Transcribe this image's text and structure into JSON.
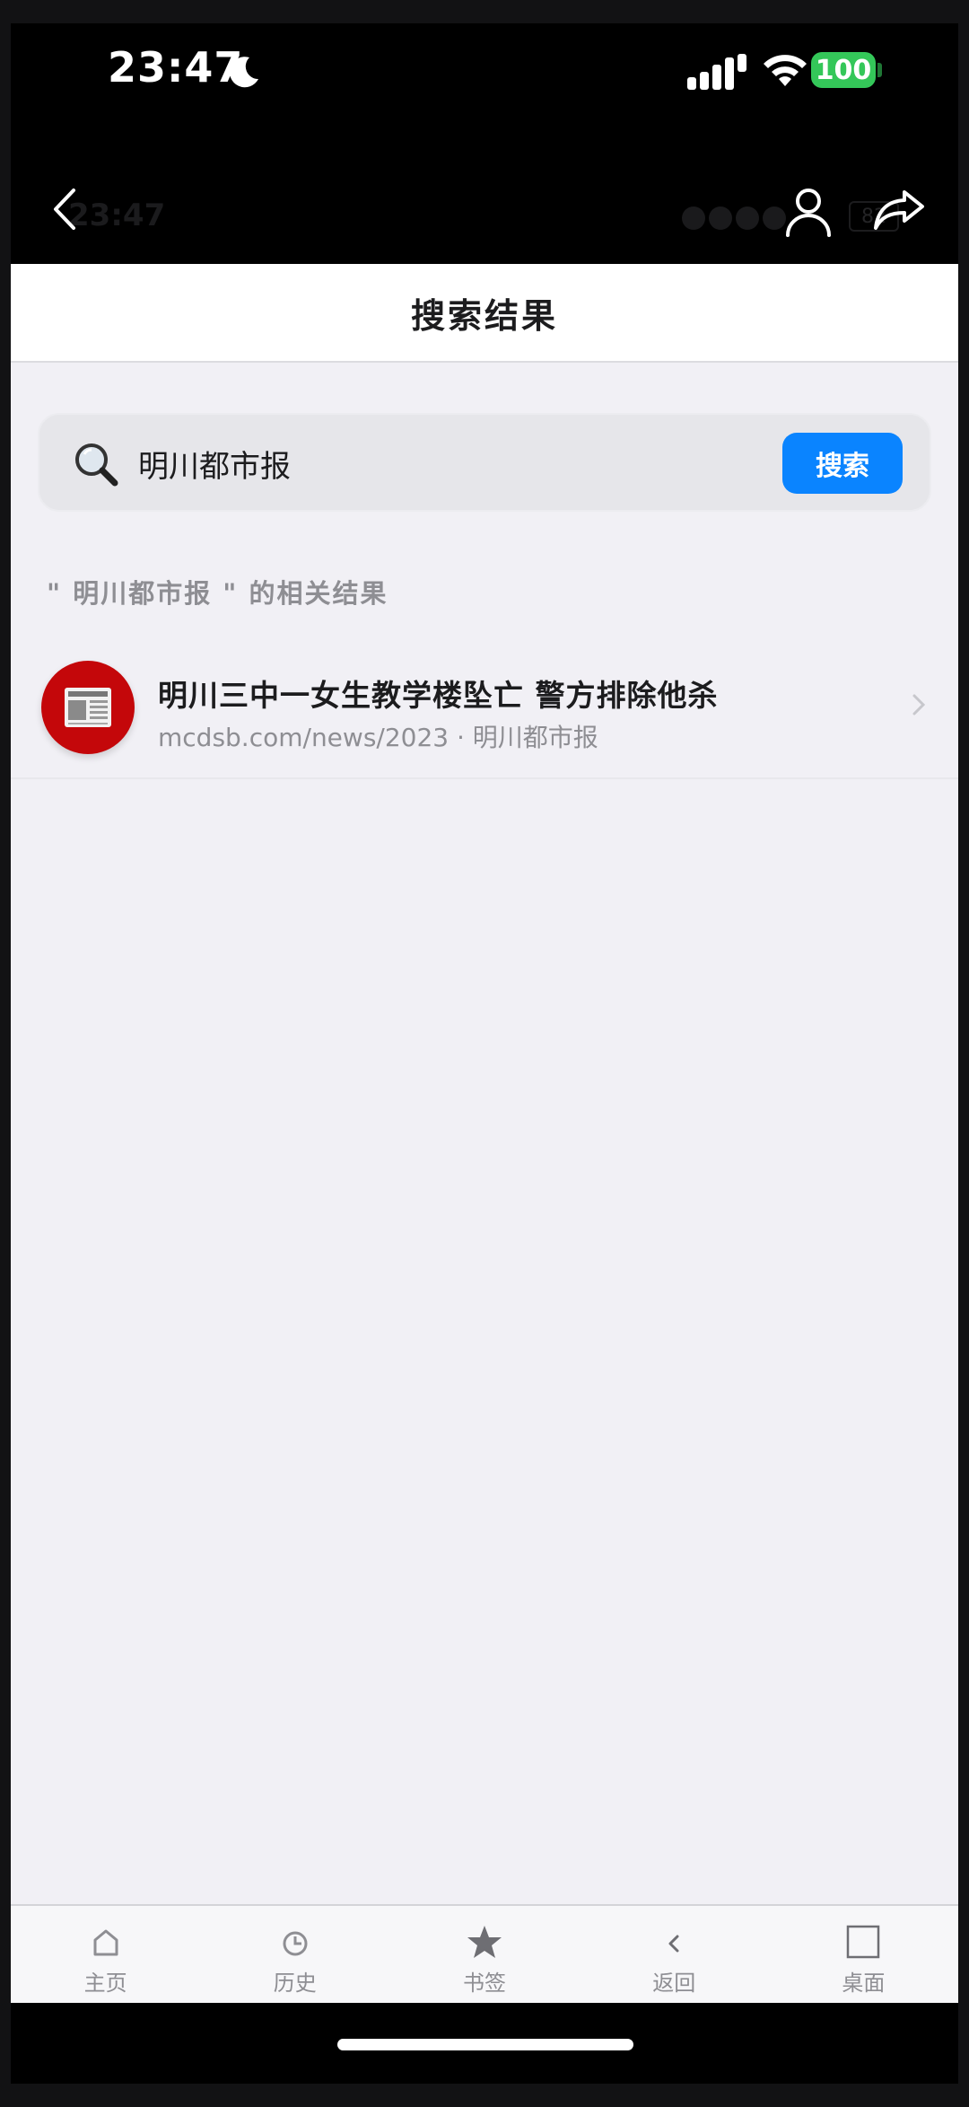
{
  "status_bar": {
    "time": "23:47",
    "battery": "100",
    "icons": [
      "moon-icon",
      "signal-icon",
      "wifi-icon",
      "battery-icon"
    ]
  },
  "ghost_status": {
    "time": "23:47",
    "battery": "82"
  },
  "nav": {
    "icons": [
      "back-icon",
      "user-icon",
      "share-icon"
    ]
  },
  "page": {
    "title": "搜索结果"
  },
  "search": {
    "value": "明川都市报",
    "button_label": "搜索"
  },
  "results": {
    "header": "\" 明川都市报 \" 的相关结果",
    "items": [
      {
        "title": "明川三中一女生教学楼坠亡 警方排除他杀",
        "subtitle": "mcdsb.com/news/2023 · 明川都市报",
        "icon": "newspaper-icon"
      }
    ]
  },
  "tab_bar": {
    "items": [
      {
        "label": "主页",
        "icon": "home-icon"
      },
      {
        "label": "历史",
        "icon": "clock-icon"
      },
      {
        "label": "书签",
        "icon": "star-icon"
      },
      {
        "label": "返回",
        "icon": "chevron-left-icon"
      },
      {
        "label": "桌面",
        "icon": "square-icon"
      }
    ]
  },
  "colors": {
    "accent": "#0a84ff",
    "battery_green": "#34c759",
    "thumb_red": "#c4070a",
    "background": "#f1f0f5"
  }
}
